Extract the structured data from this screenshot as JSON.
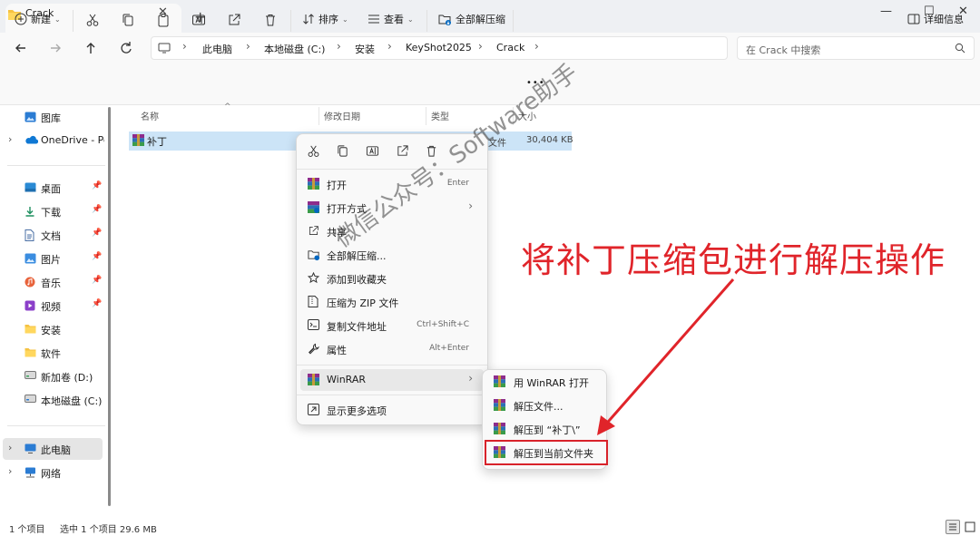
{
  "window": {
    "tab_title": "Crack",
    "tab_close": "✕",
    "new_tab": "+",
    "minimize": "—",
    "maximize": "☐",
    "close": "✕"
  },
  "address": {
    "breadcrumbs": [
      "此电脑",
      "本地磁盘 (C:)",
      "安装",
      "KeyShot2025",
      "Crack"
    ],
    "search_placeholder": "在 Crack 中搜索"
  },
  "toolbar": {
    "new_label": "新建",
    "sort_label": "排序",
    "view_label": "查看",
    "extract_all_label": "全部解压缩",
    "more_label": "•••",
    "details_label": "详细信息"
  },
  "sidebar": {
    "items": [
      {
        "label": "图库",
        "icon": "gallery-icon"
      },
      {
        "label": "OneDrive - Per",
        "icon": "onedrive-icon"
      },
      {
        "label": "桌面",
        "icon": "desktop-icon",
        "pinned": true
      },
      {
        "label": "下载",
        "icon": "download-icon",
        "pinned": true
      },
      {
        "label": "文档",
        "icon": "documents-icon",
        "pinned": true
      },
      {
        "label": "图片",
        "icon": "pictures-icon",
        "pinned": true
      },
      {
        "label": "音乐",
        "icon": "music-icon",
        "pinned": true
      },
      {
        "label": "视频",
        "icon": "videos-icon",
        "pinned": true
      },
      {
        "label": "安装",
        "icon": "folder-icon"
      },
      {
        "label": "软件",
        "icon": "folder-icon"
      },
      {
        "label": "新加卷 (D:)",
        "icon": "drive-icon"
      },
      {
        "label": "本地磁盘 (C:)",
        "icon": "drive-icon"
      },
      {
        "label": "此电脑",
        "icon": "this-pc-icon"
      },
      {
        "label": "网络",
        "icon": "network-icon"
      }
    ],
    "pin_glyph": "📌"
  },
  "columns": {
    "name": "名称",
    "modified": "修改日期",
    "type": "类型",
    "size": "大小"
  },
  "file": {
    "name": "补丁",
    "type": "文件",
    "size": "30,404 KB"
  },
  "context_menu": {
    "items": [
      {
        "label": "打开",
        "shortcut": "Enter"
      },
      {
        "label": "打开方式",
        "arrow": "›"
      },
      {
        "label": "共享"
      },
      {
        "label": "全部解压缩..."
      },
      {
        "label": "添加到收藏夹"
      },
      {
        "label": "压缩为 ZIP 文件"
      },
      {
        "label": "复制文件地址",
        "shortcut": "Ctrl+Shift+C"
      },
      {
        "label": "属性",
        "shortcut": "Alt+Enter"
      },
      {
        "label": "WinRAR",
        "arrow": "›"
      },
      {
        "label": "显示更多选项"
      }
    ]
  },
  "winrar_submenu": {
    "items": [
      {
        "label": "用 WinRAR 打开"
      },
      {
        "label": "解压文件..."
      },
      {
        "label": "解压到 “补丁\\”"
      },
      {
        "label": "解压到当前文件夹"
      }
    ]
  },
  "status": {
    "count": "1 个项目",
    "selected": "选中 1 个项目  29.6 MB"
  },
  "annotation": {
    "text": "将补丁压缩包进行解压操作",
    "watermark": "微信公众号：Software助手",
    "color": "#e0242a"
  },
  "colors": {
    "selection": "#cce4f7",
    "accent": "#0067c0",
    "highlight_border": "#d8222a"
  }
}
